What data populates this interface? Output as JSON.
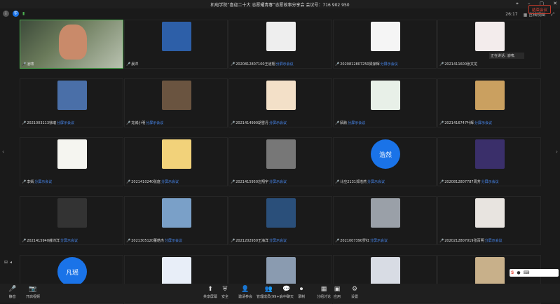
{
  "title": "机电学院“喜迎二十大 志愿耀青春”志愿故事分享会 会议号：716 902 950",
  "topbar": {
    "time": "26:17",
    "view_label": "宫格视图"
  },
  "speaking": "正在讲话: 凌啸;",
  "tiles": [
    {
      "name": "凌啸",
      "link": "",
      "kind": "video"
    },
    {
      "name": "晨洋",
      "link": "",
      "kind": "img",
      "color": "#2d5fa8"
    },
    {
      "name": "2020812807100王道翔",
      "link": "分屏示会议",
      "kind": "img",
      "color": "#eee"
    },
    {
      "name": "2020812807250梁家辉",
      "link": "分屏示会议",
      "kind": "img",
      "color": "#f5f5f5"
    },
    {
      "name": "2021411600张文龙",
      "link": "",
      "kind": "img",
      "color": "#f3ecec"
    },
    {
      "name": "2021003113徐瑞",
      "link": "分屏示会议",
      "kind": "img",
      "color": "#4a6fa8"
    },
    {
      "name": "龙城小明",
      "link": "分屏示会议",
      "kind": "img",
      "color": "#6a5440"
    },
    {
      "name": "2021414990胡雪丹",
      "link": "分屏示会议",
      "kind": "img",
      "color": "#f3e0c8"
    },
    {
      "name": "陌默",
      "link": "分屏示会议",
      "kind": "img",
      "color": "#e8f0e8"
    },
    {
      "name": "2021416747叶辉",
      "link": "分屏示会议",
      "kind": "img",
      "color": "#caa060"
    },
    {
      "name": "李嫣",
      "link": "分屏示会议",
      "kind": "img",
      "color": "#f5f5f0"
    },
    {
      "name": "2021410240张庭",
      "link": "分屏示会议",
      "kind": "img",
      "color": "#f2d27a"
    },
    {
      "name": "2021415950左翔宇",
      "link": "分屏示会议",
      "kind": "img",
      "color": "#777"
    },
    {
      "name": "计应2131郑浩然",
      "link": "分屏示会议",
      "kind": "circle",
      "initial": "浩然"
    },
    {
      "name": "2020812807787周芳",
      "link": "分屏示会议",
      "kind": "img",
      "color": "#3a2f6a"
    },
    {
      "name": "2021415940薛沛洋",
      "link": "分屏示会议",
      "kind": "img",
      "color": "#333"
    },
    {
      "name": "2021305120董皓杰",
      "link": "分屏示会议",
      "kind": "img",
      "color": "#7aa0c8"
    },
    {
      "name": "2021202930王海洋",
      "link": "分屏示会议",
      "kind": "img",
      "color": "#2a4f7a"
    },
    {
      "name": "2021007390罗红",
      "link": "分屏示会议",
      "kind": "img",
      "color": "#9aa0a8"
    },
    {
      "name": "2020212807019张百明",
      "link": "分屏示会议",
      "kind": "img",
      "color": "#e8e4e0"
    },
    {
      "name": "",
      "link": "",
      "kind": "circle",
      "initial": "凡瑶"
    },
    {
      "name": "",
      "link": "",
      "kind": "img",
      "color": "#e8eef8"
    },
    {
      "name": "",
      "link": "",
      "kind": "img",
      "color": "#8a9bb0"
    },
    {
      "name": "",
      "link": "",
      "kind": "img",
      "color": "#d8dce4"
    },
    {
      "name": "",
      "link": "",
      "kind": "img",
      "color": "#c8b08a"
    }
  ],
  "toolbar": [
    {
      "id": "mute",
      "label": "静音",
      "glyph": "🎤"
    },
    {
      "id": "video",
      "label": "开启视频",
      "glyph": "📷"
    },
    {
      "id": "share",
      "label": "共享屏幕",
      "glyph": "⬆"
    },
    {
      "id": "security",
      "label": "安全",
      "glyph": "⛨"
    },
    {
      "id": "invite",
      "label": "邀请参会",
      "glyph": "👤"
    },
    {
      "id": "members",
      "label": "管理成员(99+)",
      "glyph": "👥"
    },
    {
      "id": "chat",
      "label": "会中聊天",
      "glyph": "💬"
    },
    {
      "id": "record",
      "label": "录制",
      "glyph": "⏺"
    },
    {
      "id": "breakout",
      "label": "分组讨论",
      "glyph": "▦"
    },
    {
      "id": "apps",
      "label": "应用",
      "glyph": "▣"
    },
    {
      "id": "settings",
      "label": "设置",
      "glyph": "⚙"
    }
  ],
  "end_label": "结束会议"
}
